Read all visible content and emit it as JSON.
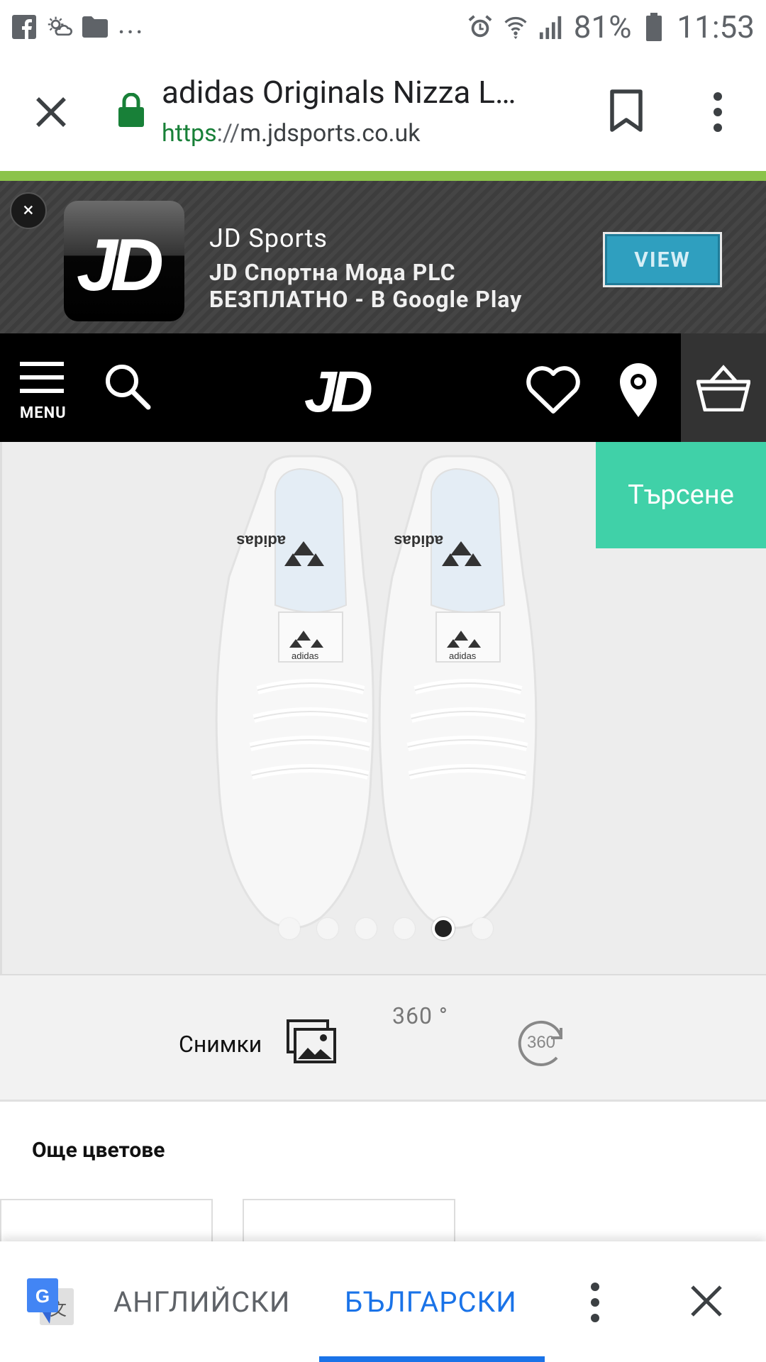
{
  "status_bar": {
    "notification_dots": "...",
    "battery": "81%",
    "time": "11:53"
  },
  "browser": {
    "page_title": "adidas Originals Nizza L…",
    "url_scheme": "https",
    "url_separator": "://",
    "url_host": "m.jdsports.co.uk"
  },
  "app_banner": {
    "close_label": "×",
    "app_name": "JD Sports",
    "developer": "JD Спортна Мода PLC",
    "price": "БЕЗПЛАТНО - В Google Play",
    "view_label": "VIEW"
  },
  "site_nav": {
    "menu_label": "MENU"
  },
  "product": {
    "search_tab_label": "Търсене",
    "carousel": {
      "total": 6,
      "active_index": 4
    }
  },
  "view_modes": {
    "photos_label": "Снимки",
    "degrees_label": "360 °",
    "icon_360_text": "360"
  },
  "more_colours": {
    "title": "Още цветове"
  },
  "translate_bar": {
    "source_lang": "АНГЛИЙСКИ",
    "target_lang": "БЪЛГАРСКИ",
    "active_color": "#1a73e8"
  },
  "colors": {
    "progress_green": "#8bc34a",
    "search_tab": "#40d1a8",
    "view_button": "#2f9fbf"
  }
}
